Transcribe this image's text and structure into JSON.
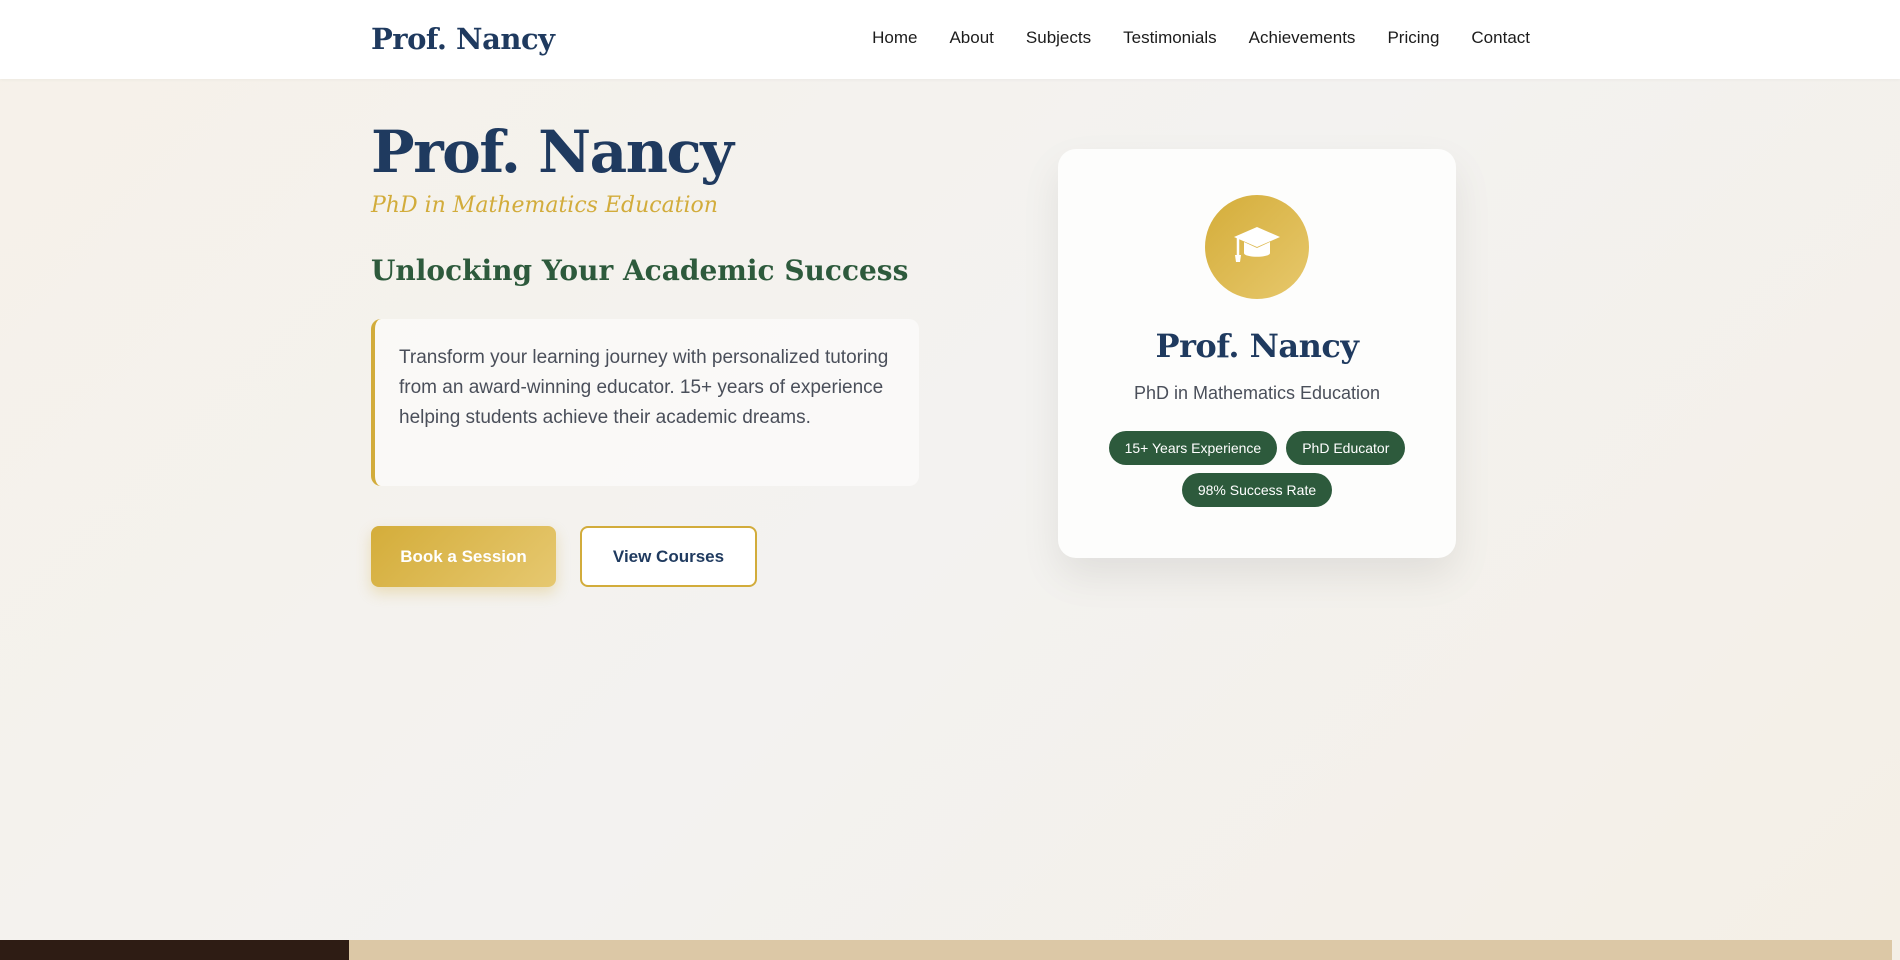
{
  "header": {
    "brand": "Prof. Nancy",
    "nav": [
      "Home",
      "About",
      "Subjects",
      "Testimonials",
      "Achievements",
      "Pricing",
      "Contact"
    ]
  },
  "hero": {
    "title": "Prof. Nancy",
    "subtitle": "PhD in Mathematics Education",
    "tagline": "Unlocking Your Academic Success",
    "description": "Transform your learning journey with personalized tutoring from an award-winning educator. 15+ years of experience helping students achieve their academic dreams.",
    "primary_button": "Book a Session",
    "secondary_button": "View Courses"
  },
  "card": {
    "icon": "graduation-cap-icon",
    "name": "Prof. Nancy",
    "subtitle": "PhD in Mathematics Education",
    "badges": [
      "15+ Years Experience",
      "PhD Educator",
      "98% Success Rate"
    ]
  },
  "colors": {
    "navy": "#1f3a5f",
    "gold": "#d2ac3b",
    "green": "#2d5a3c"
  }
}
